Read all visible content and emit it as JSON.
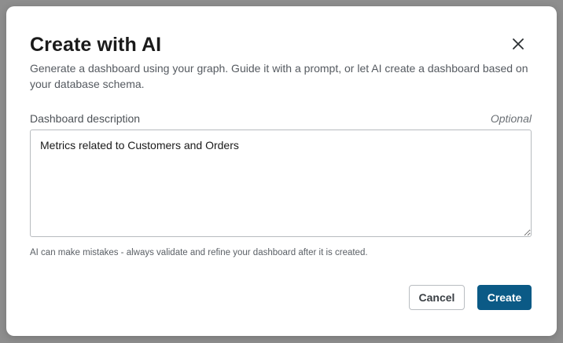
{
  "dialog": {
    "title": "Create with AI",
    "subtitle": "Generate a dashboard using your graph. Guide it with a prompt, or let AI create a dashboard based on your database schema.",
    "close_icon": "close-icon"
  },
  "form": {
    "description_label": "Dashboard description",
    "optional_label": "Optional",
    "description_value": "Metrics related to Customers and Orders",
    "hint": "AI can make mistakes - always validate and refine your dashboard after it is created."
  },
  "actions": {
    "cancel_label": "Cancel",
    "create_label": "Create"
  },
  "colors": {
    "primary": "#0b5a86",
    "backdrop": "#8e8e8e"
  }
}
